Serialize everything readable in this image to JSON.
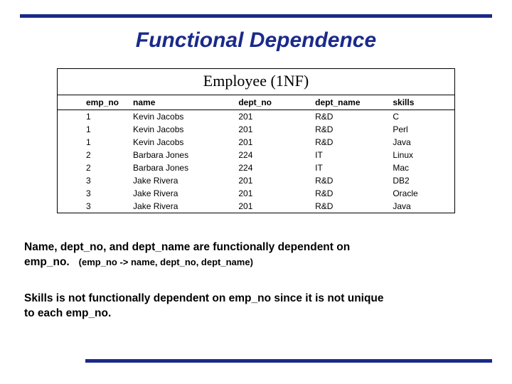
{
  "title": "Functional Dependence",
  "table": {
    "title": "Employee (1NF)",
    "headers": {
      "emp_no": "emp_no",
      "name": "name",
      "dept_no": "dept_no",
      "dept_name": "dept_name",
      "skills": "skills"
    },
    "rows": [
      {
        "emp_no": "1",
        "name": "Kevin Jacobs",
        "dept_no": "201",
        "dept_name": "R&D",
        "skills": "C"
      },
      {
        "emp_no": "1",
        "name": "Kevin Jacobs",
        "dept_no": "201",
        "dept_name": "R&D",
        "skills": "Perl"
      },
      {
        "emp_no": "1",
        "name": "Kevin Jacobs",
        "dept_no": "201",
        "dept_name": "R&D",
        "skills": "Java"
      },
      {
        "emp_no": "2",
        "name": "Barbara Jones",
        "dept_no": "224",
        "dept_name": "IT",
        "skills": "Linux"
      },
      {
        "emp_no": "2",
        "name": "Barbara Jones",
        "dept_no": "224",
        "dept_name": "IT",
        "skills": "Mac"
      },
      {
        "emp_no": "3",
        "name": "Jake Rivera",
        "dept_no": "201",
        "dept_name": "R&D",
        "skills": "DB2"
      },
      {
        "emp_no": "3",
        "name": "Jake Rivera",
        "dept_no": "201",
        "dept_name": "R&D",
        "skills": "Oracle"
      },
      {
        "emp_no": "3",
        "name": "Jake Rivera",
        "dept_no": "201",
        "dept_name": "R&D",
        "skills": "Java"
      }
    ]
  },
  "caption1": {
    "line1_a": "Name, dept_no, and dept_name are functionally dependent on",
    "line2_a": "emp_no.",
    "line2_b": "(emp_no -> name, dept_no, dept_name)"
  },
  "caption2": {
    "line1": "Skills is not functionally dependent on emp_no since it is not unique",
    "line2": "to each emp_no."
  }
}
